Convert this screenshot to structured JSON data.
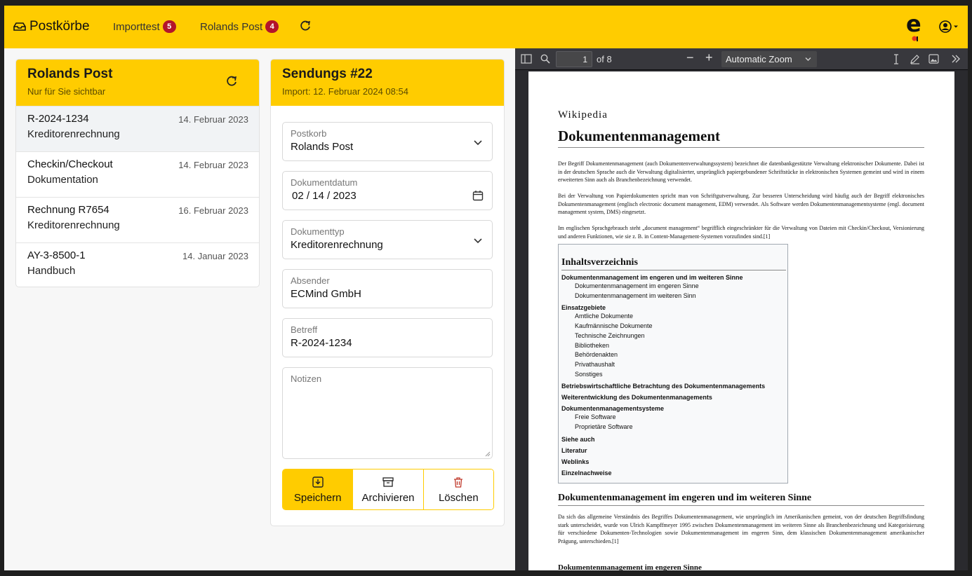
{
  "header": {
    "brand": "Postkörbe",
    "nav": [
      {
        "label": "Importtest",
        "count": "5"
      },
      {
        "label": "Rolands Post",
        "count": "4"
      }
    ]
  },
  "mailbox": {
    "title": "Rolands Post",
    "subtitle": "Nur für Sie sichtbar",
    "items": [
      {
        "title": "R-2024-1234",
        "date": "14. Februar 2023",
        "type": "Kreditorenrechnung"
      },
      {
        "title": "Checkin/Checkout",
        "date": "14. Februar 2023",
        "type": "Dokumentation"
      },
      {
        "title": "Rechnung R7654",
        "date": "16. Februar 2023",
        "type": "Kreditorenrechnung"
      },
      {
        "title": "AY-3-8500-1",
        "date": "14. Januar 2023",
        "type": "Handbuch"
      }
    ]
  },
  "shipment": {
    "title": "Sendungs #22",
    "subtitle": "Import: 12. Februar 2024 08:54",
    "fields": {
      "postkorb": {
        "label": "Postkorb",
        "value": "Rolands Post"
      },
      "dokumentdatum": {
        "label": "Dokumentdatum",
        "value": "02 / 14 / 2023"
      },
      "dokumenttyp": {
        "label": "Dokumenttyp",
        "value": "Kreditorenrechnung"
      },
      "absender": {
        "label": "Absender",
        "value": "ECMind GmbH"
      },
      "betreff": {
        "label": "Betreff",
        "value": "R-2024-1234"
      },
      "notizen": {
        "label": "Notizen",
        "value": ""
      }
    },
    "actions": {
      "save": "Speichern",
      "archive": "Archivieren",
      "delete": "Löschen"
    }
  },
  "viewer": {
    "page": "1",
    "page_count": "of 8",
    "zoom": "Automatic Zoom",
    "doc": {
      "site": "Wikipedia",
      "title": "Dokumentenmanagement",
      "p1": "Der Begriff Dokumentenmanagement (auch Dokumentenverwaltungssystem) bezeichnet die datenbankgestützte Verwaltung elektronischer Dokumente. Dabei ist in der deutschen Sprache auch die Verwaltung digitalisierter, ursprünglich papiergebundener Schriftstücke in elektronischen Systemen gemeint und wird in einem erweiterten Sinn auch als Branchenbezeichnung verwendet.",
      "p2": "Bei der Verwaltung von Papierdokumenten spricht man von Schriftgutverwaltung. Zur besseren Unterscheidung wird häufig auch der Begriff elektronisches Dokumentenmanagement (englisch electronic document management, EDM) verwendet. Als Software werden Dokumentenmanagementsysteme (engl. document management system, DMS) eingesetzt.",
      "p3": "Im englischen Sprachgebrauch steht „document management“ begrifflich eingeschränkter für die Verwaltung von Dateien mit Checkin/Checkout, Versionierung und anderen Funktionen, wie sie z. B. in Content-Management-Systemen vorzufinden sind.[1]",
      "toc_title": "Inhaltsverzeichnis",
      "toc": [
        {
          "h": "Dokumentenmanagement im engeren und im weiteren Sinne",
          "subs": [
            "Dokumentenmanagement im engeren Sinne",
            "Dokumentenmanagement im weiteren Sinn"
          ]
        },
        {
          "h": "Einsatzgebiete",
          "subs": [
            "Amtliche Dokumente",
            "Kaufmännische Dokumente",
            "Technische Zeichnungen",
            "Bibliotheken",
            "Behördenakten",
            "Privathaushalt",
            "Sonstiges"
          ]
        },
        {
          "h": "Betriebswirtschaftliche Betrachtung des Dokumentenmanagements",
          "subs": []
        },
        {
          "h": "Weiterentwicklung des Dokumentenmanagements",
          "subs": []
        },
        {
          "h": "Dokumentenmanagementsysteme",
          "subs": [
            "Freie Software",
            "Proprietäre Software"
          ]
        },
        {
          "h": "Siehe auch",
          "subs": []
        },
        {
          "h": "Literatur",
          "subs": []
        },
        {
          "h": "Weblinks",
          "subs": []
        },
        {
          "h": "Einzelnachweise",
          "subs": []
        }
      ],
      "h2": "Dokumentenmanagement im engeren und im weiteren Sinne",
      "p4": "Da sich das allgemeine Verständnis des Begriffes Dokumentenmanagement, wie ursprünglich im Amerikanischen gemeint, von der deutschen Begriffsfindung stark unterscheidet, wurde von Ulrich Kampffmeyer 1995 zwischen Dokumentenmanagement im weiteren Sinne als Branchenbezeichnung und Kategorisierung für verschiedene Dokumenten-Technologien sowie Dokumentenmanagement im engeren Sinn, dem klassischen Dokumentenmanagement amerikanischer Prägung, unterschieden.[1]",
      "h3": "Dokumentenmanagement im engeren Sinne"
    }
  }
}
